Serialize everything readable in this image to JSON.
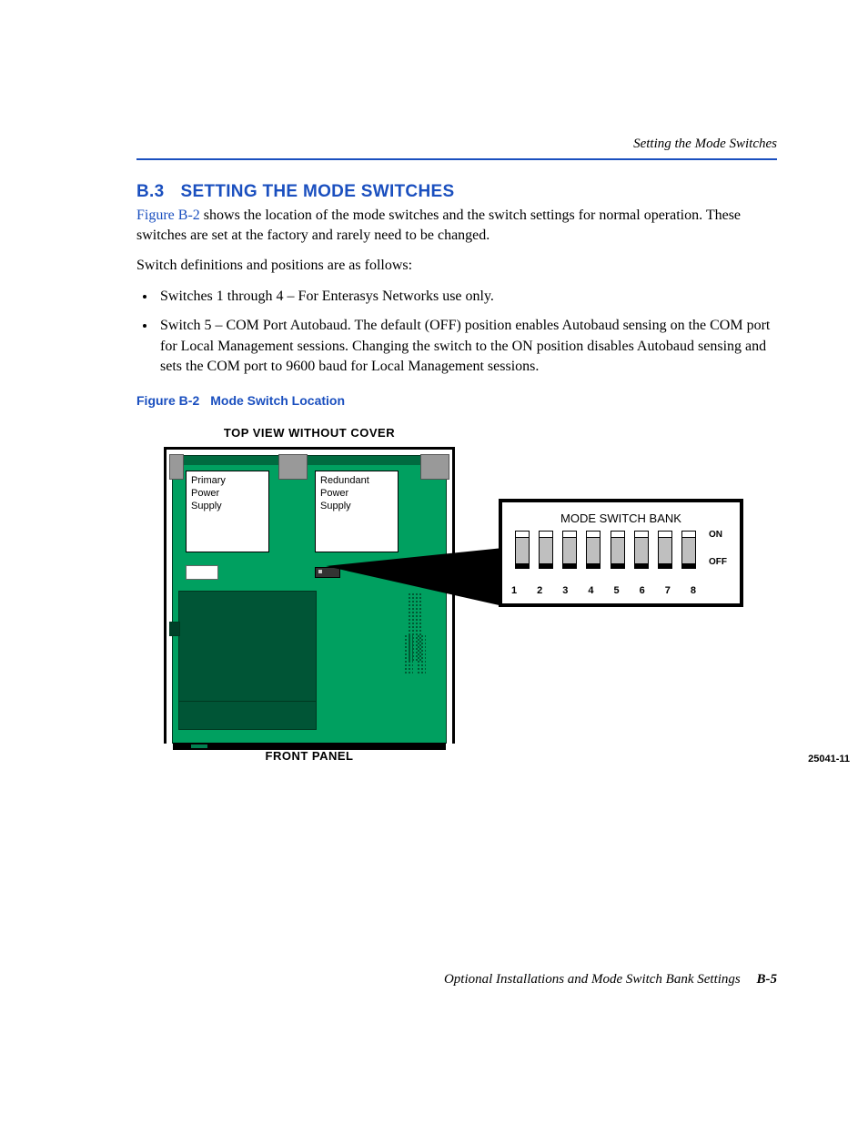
{
  "header": {
    "running": "Setting the Mode Switches"
  },
  "section": {
    "number": "B.3",
    "title": "SETTING THE MODE SWITCHES",
    "intro_link": "Figure B-2",
    "intro_rest": " shows the location of the mode switches and the switch settings for normal operation. These switches are set at the factory and rarely need to be changed.",
    "defs": "Switch definitions and positions are as follows:",
    "bullets": [
      "Switches 1 through 4 – For Enterasys Networks use only.",
      "Switch 5 – COM Port Autobaud. The default (OFF) position enables Autobaud sensing on the COM port for Local Management sessions. Changing the switch to the ON position disables Autobaud sensing and sets the COM port to 9600 baud for Local Management sessions."
    ]
  },
  "figure": {
    "caption_num": "Figure B-2",
    "caption_title": "Mode Switch Location",
    "top_label": "TOP VIEW WITHOUT COVER",
    "bottom_label": "FRONT PANEL",
    "psu1": "Primary\nPower\nSupply",
    "psu2": "Redundant\nPower\nSupply",
    "detail_title": "MODE SWITCH BANK",
    "side_on": "ON",
    "side_off": "OFF",
    "nums": [
      "1",
      "2",
      "3",
      "4",
      "5",
      "6",
      "7",
      "8"
    ],
    "id": "25041-11"
  },
  "footer": {
    "title": "Optional Installations and Mode Switch Bank Settings",
    "page": "B-5"
  }
}
